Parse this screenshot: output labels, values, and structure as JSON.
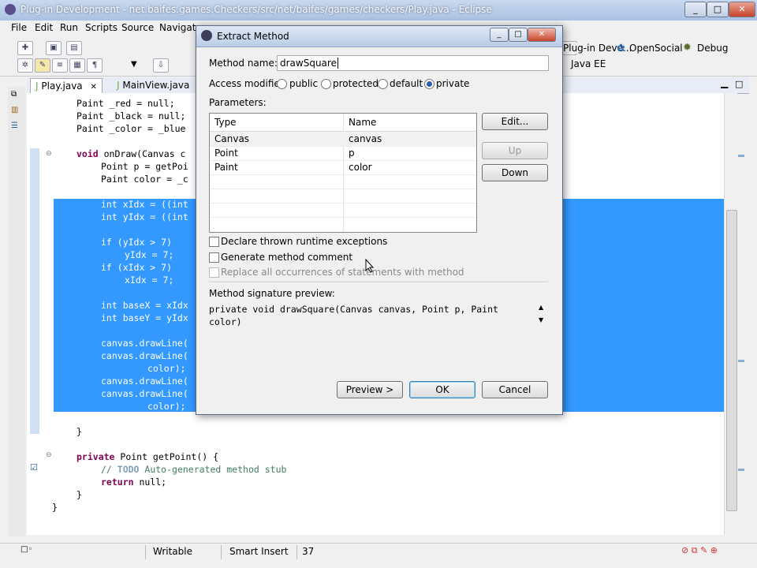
{
  "window": {
    "title": "Plug-in Development - net.baifes.games.Checkers/src/net/baifes/games/checkers/Play.java - Eclipse"
  },
  "menu": [
    "File",
    "Edit",
    "Run",
    "Scripts",
    "Source",
    "Navigate"
  ],
  "perspectives": {
    "plugin": "Plug-in Deve...",
    "opensocial": "OpenSocial",
    "debug": "Debug",
    "javaee": "Java EE"
  },
  "tabs": [
    {
      "label": "Play.java"
    },
    {
      "label": "MainView.java"
    }
  ],
  "code": {
    "l1": "Paint _red = null;",
    "l2": "Paint _black = null;",
    "l3": "Paint _color = _blue",
    "l4a": "void",
    "l4b": " onDraw(Canvas c",
    "l5": "Point p = getPoi",
    "l6": "Paint color = _c",
    "s1": "int xIdx = ((int",
    "s2": "int yIdx = ((int",
    "s3": "if (yIdx > 7)",
    "s4": "yIdx = 7;",
    "s5": "if (xIdx > 7)",
    "s6": "xIdx = 7;",
    "s7": "int baseX = xIdx",
    "s8": "int baseY = yIdx",
    "s9": "canvas.drawLine(",
    "s10": "canvas.drawLine(",
    "s11": "color);",
    "s12": "canvas.drawLine(",
    "s13": "canvas.drawLine(",
    "s14": "color);",
    "c1": "}",
    "c2a": "private",
    "c2b": " Point getPoint() {",
    "c3a": "// ",
    "c3b": "TODO",
    "c3c": " Auto-generated method stub",
    "c4a": "return",
    "c4b": " null;",
    "c5": "}",
    "c6": "}"
  },
  "status": {
    "writable": "Writable",
    "insert": "Smart Insert",
    "position": "37"
  },
  "dialog": {
    "title": "Extract Method",
    "method_name_label": "Method name:",
    "method_name_value": "drawSquare",
    "access_label": "Access modifier:",
    "access_options": [
      "public",
      "protected",
      "default",
      "private"
    ],
    "access_selected": "private",
    "parameters_label": "Parameters:",
    "columns": [
      "Type",
      "Name"
    ],
    "params": [
      {
        "type": "Canvas",
        "name": "canvas"
      },
      {
        "type": "Point",
        "name": "p"
      },
      {
        "type": "Paint",
        "name": "color"
      }
    ],
    "buttons": {
      "edit": "Edit...",
      "up": "Up",
      "down": "Down",
      "preview": "Preview >",
      "ok": "OK",
      "cancel": "Cancel"
    },
    "declare_exceptions": "Declare thrown runtime exceptions",
    "generate_comment": "Generate method comment",
    "replace_all": "Replace all occurrences of statements with method",
    "signature_label": "Method signature preview:",
    "signature_line1": "private void drawSquare(Canvas canvas, Point p, Paint",
    "signature_line2": "color)"
  }
}
